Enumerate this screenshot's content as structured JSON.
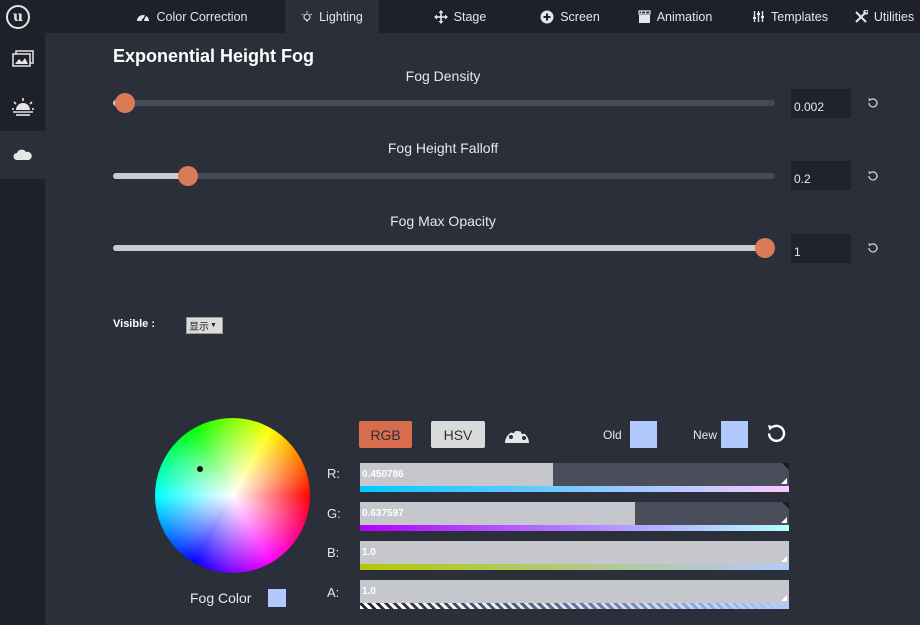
{
  "nav": {
    "logo": "u",
    "tabs": [
      {
        "label": "Color Correction",
        "icon": "gauge-icon"
      },
      {
        "label": "Lighting",
        "icon": "lightbulb-icon",
        "active": true
      },
      {
        "label": "Stage",
        "icon": "move-icon"
      },
      {
        "label": "Screen",
        "icon": "plus-circle-icon"
      },
      {
        "label": "Animation",
        "icon": "clapperboard-icon"
      },
      {
        "label": "Templates",
        "icon": "sliders-icon"
      },
      {
        "label": "Utilities",
        "icon": "tools-icon"
      }
    ]
  },
  "sidebar": {
    "items": [
      {
        "icon": "image-gallery-icon"
      },
      {
        "icon": "sunrise-icon"
      },
      {
        "icon": "cloud-icon",
        "active": true
      }
    ]
  },
  "section": {
    "title": "Exponential Height Fog"
  },
  "sliders": [
    {
      "label": "Fog Density",
      "value": "0.002",
      "level": 0.018
    },
    {
      "label": "Fog Height Falloff",
      "value": "0.2",
      "level": 0.113
    },
    {
      "label": "Fog Max Opacity",
      "value": "1",
      "level": 0.985
    }
  ],
  "visible": {
    "label": "Visible :",
    "value": "显示"
  },
  "color_picker": {
    "label": "Fog Color",
    "color": "#b1c9fc",
    "mode_buttons": {
      "rgb": "RGB",
      "hsv": "HSV"
    },
    "old_label": "Old",
    "new_label": "New",
    "channels": [
      {
        "label": "R:",
        "value": "0.450786",
        "level": 0.45
      },
      {
        "label": "G:",
        "value": "0.637597",
        "level": 0.64
      },
      {
        "label": "B:",
        "value": "1.0",
        "level": 1.0
      },
      {
        "label": "A:",
        "value": "1.0",
        "level": 1.0
      }
    ]
  },
  "colors": {
    "accent": "#d97a59",
    "background": "#2b2f3a",
    "bar": "#1e2129"
  }
}
